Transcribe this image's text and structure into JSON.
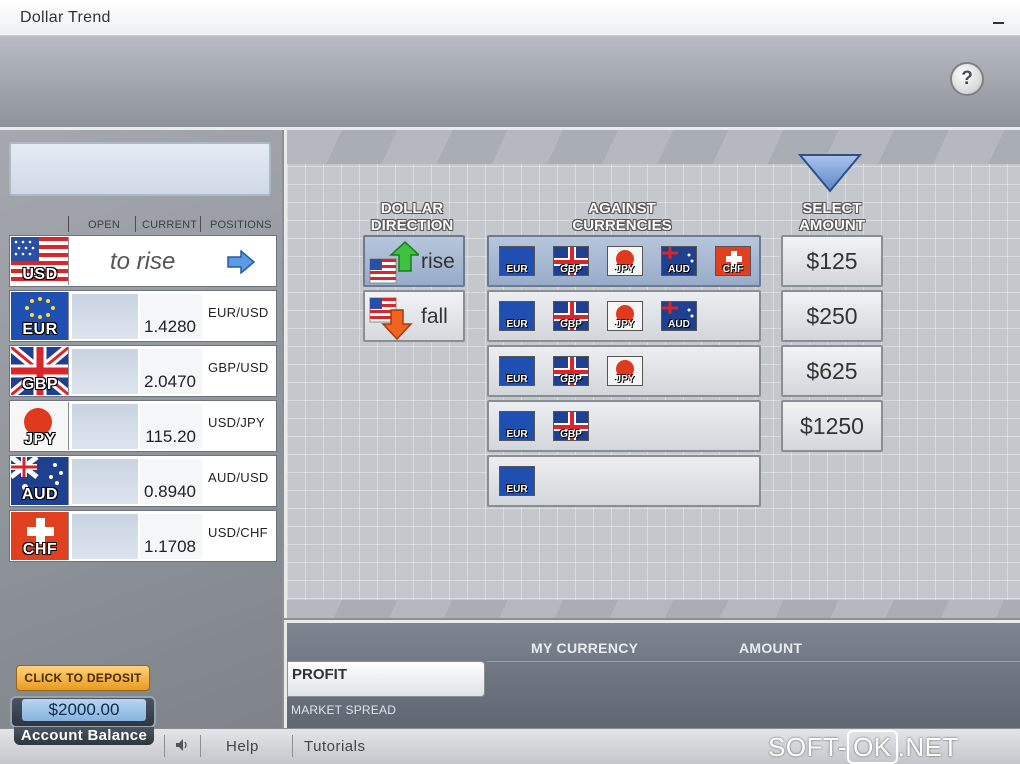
{
  "window": {
    "title": "Dollar Trend"
  },
  "header": {
    "help_label": "?"
  },
  "left_panel": {
    "columns": {
      "open": "OPEN",
      "current": "CURRENT",
      "positions": "POSITIONS"
    },
    "usd_row": {
      "code": "USD",
      "direction_text": "to rise"
    },
    "rows": [
      {
        "code": "EUR",
        "current": "1.4280",
        "pair": "EUR/USD"
      },
      {
        "code": "GBP",
        "current": "2.0470",
        "pair": "GBP/USD"
      },
      {
        "code": "JPY",
        "current": "115.20",
        "pair": "USD/JPY"
      },
      {
        "code": "AUD",
        "current": "0.8940",
        "pair": "AUD/USD"
      },
      {
        "code": "CHF",
        "current": "1.1708",
        "pair": "USD/CHF"
      }
    ],
    "deposit_button": "CLICK TO DEPOSIT",
    "balance_amount": "$2000.00",
    "balance_label": "Account Balance"
  },
  "main": {
    "dollar_direction_title_1": "DOLLAR",
    "dollar_direction_title_2": "DIRECTION",
    "against_title_1": "AGAINST",
    "against_title_2": "CURRENCIES",
    "select_amount_title_1": "SELECT",
    "select_amount_title_2": "AMOUNT",
    "direction": {
      "rise": "rise",
      "fall": "fall",
      "selected": "rise"
    },
    "against_rows": [
      {
        "codes": [
          "EUR",
          "GBP",
          "JPY",
          "AUD",
          "CHF"
        ],
        "selected": true
      },
      {
        "codes": [
          "EUR",
          "GBP",
          "JPY",
          "AUD"
        ],
        "selected": false
      },
      {
        "codes": [
          "EUR",
          "GBP",
          "JPY"
        ],
        "selected": false
      },
      {
        "codes": [
          "EUR",
          "GBP"
        ],
        "selected": false
      },
      {
        "codes": [
          "EUR"
        ],
        "selected": false
      }
    ],
    "amounts": [
      "$125",
      "$250",
      "$625",
      "$1250"
    ]
  },
  "info_panel": {
    "my_currency": "MY CURRENCY",
    "amount": "AMOUNT",
    "profit": "PROFIT",
    "market_spread": "MARKET SPREAD"
  },
  "bottom_bar": {
    "sound_icon": "speaker-icon",
    "help": "Help",
    "tutorials": "Tutorials",
    "watermark_1": "SOFT-",
    "watermark_2": "OK",
    "watermark_3": ".NET"
  },
  "colors": {
    "eur_blue": "#1f4fb0",
    "jpy_red": "#e03a1e",
    "chf_red": "#e04020",
    "deposit_orange": "#f0a83a",
    "selected_blue": "#a9bbd4"
  }
}
